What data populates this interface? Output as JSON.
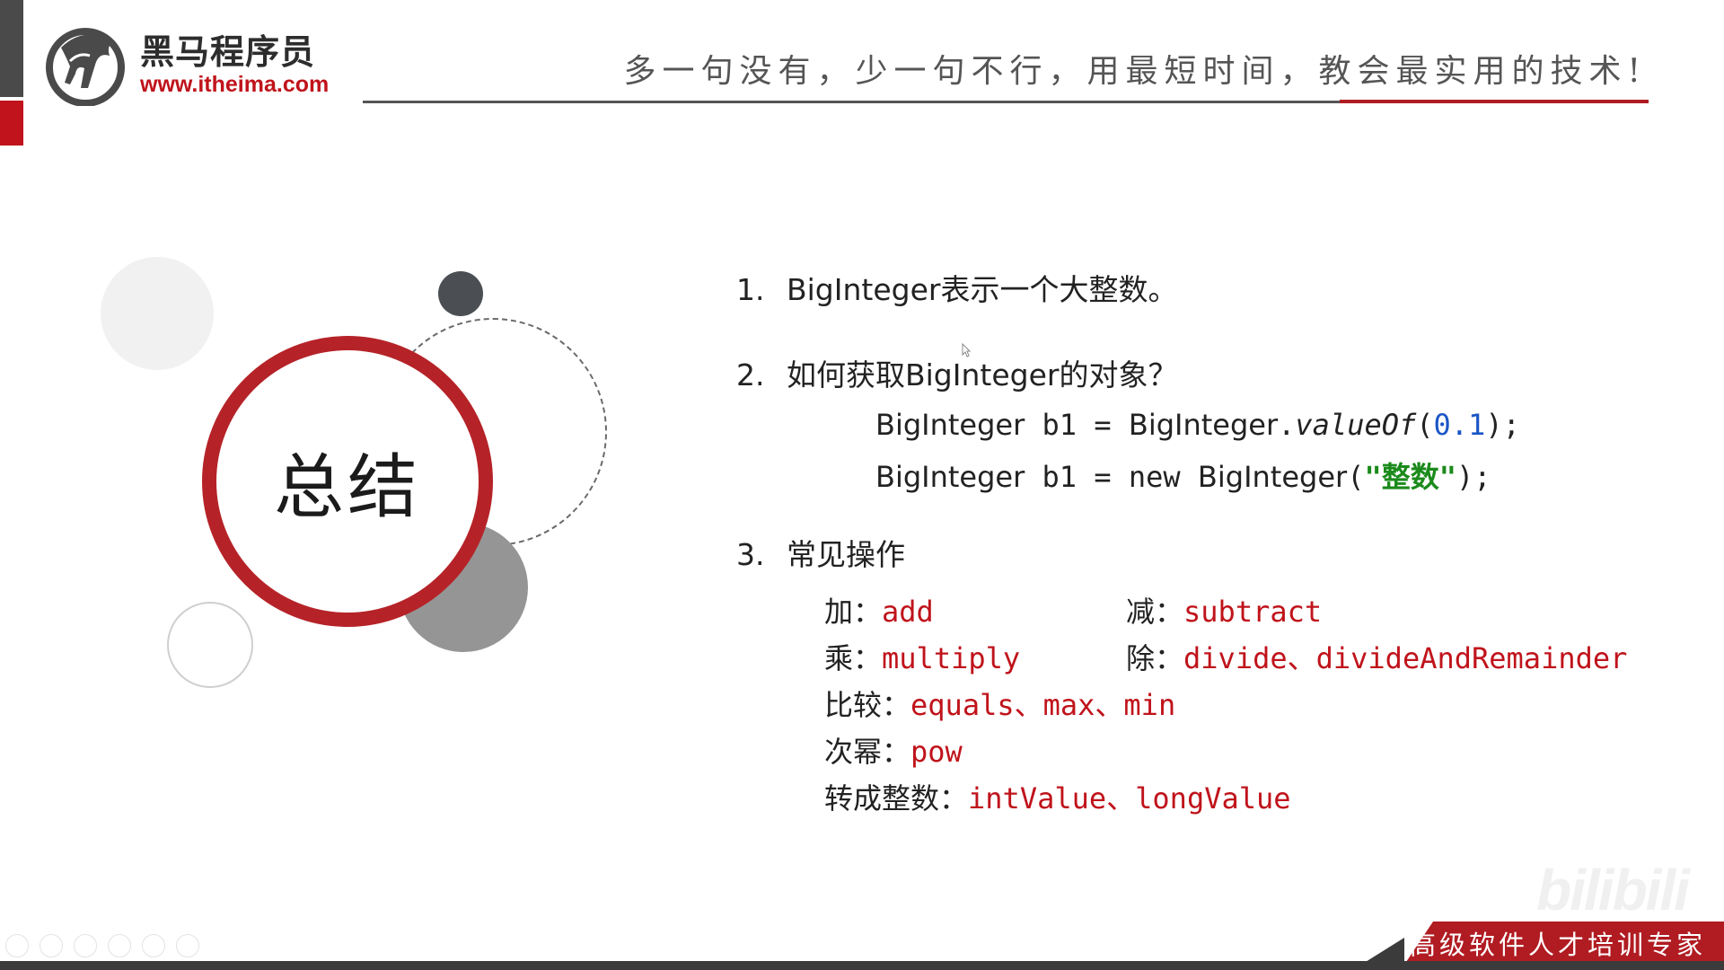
{
  "header": {
    "logo_name": "黑马程序员",
    "logo_url": "www.itheima.com",
    "slogan": "多一句没有，少一句不行，用最短时间，教会最实用的技术!"
  },
  "summary": {
    "title": "总结"
  },
  "points": [
    {
      "num": "1.",
      "text": "BigInteger表示一个大整数。"
    },
    {
      "num": "2.",
      "text": "如何获取BigInteger的对象？"
    },
    {
      "num": "3.",
      "text": "常见操作"
    }
  ],
  "code": {
    "line1": {
      "type": "BigInteger",
      "rest": " b1 = ",
      "cls": "BigInteger",
      "dot": ".",
      "method": "valueOf",
      "open": "(",
      "arg": "0.1",
      "close": ");"
    },
    "line2": {
      "type": "BigInteger",
      "rest": " b1 = new ",
      "cls": "BigInteger",
      "open": "(",
      "arg": "\"整数\"",
      "close": ");"
    }
  },
  "operations": [
    {
      "label": "加：",
      "value": "add"
    },
    {
      "label": "减：",
      "value": "subtract"
    },
    {
      "label": "乘：",
      "value": "multiply"
    },
    {
      "label": "除：",
      "value": "divide、divideAndRemainder"
    },
    {
      "label": "比较：",
      "value": "equals、max、min"
    },
    {
      "label": "次幂：",
      "value": "pow"
    },
    {
      "label": "转成整数：",
      "value": "intValue、longValue"
    }
  ],
  "footer": {
    "tagline": "高级软件人才培训专家",
    "watermark": "bilibili"
  },
  "colors": {
    "brand_red": "#c0131b",
    "string_green": "#1b8a1b",
    "number_blue": "#1a55c5"
  }
}
